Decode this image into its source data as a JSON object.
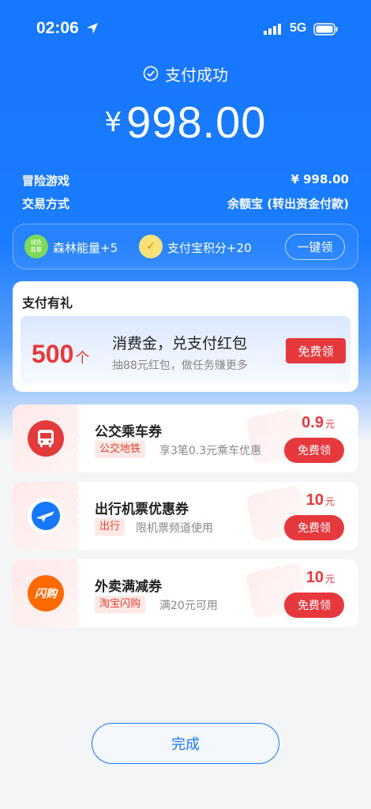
{
  "status_bar": {
    "time": "02:06",
    "network": "5G",
    "icons": [
      "location-arrow-icon",
      "signal-icon",
      "battery-icon"
    ]
  },
  "header": {
    "status_text": "支付成功",
    "currency": "¥",
    "amount": "998.00"
  },
  "details": {
    "item_label": "冒险游戏",
    "item_value": "¥ 998.00",
    "method_label": "交易方式",
    "method_value": "余额宝 (转出资金付款)"
  },
  "bonus_bar": {
    "forest_icon_text": "绿色能量",
    "forest_label": "森林能量+5",
    "points_label": "支付宝积分+20",
    "collect_all_button": "一键领"
  },
  "gift": {
    "title": "支付有礼",
    "count": "500",
    "count_unit": "个",
    "headline": "消费金，兑支付红包",
    "subline": "抽88元红包，做任务赚更多",
    "button": "免费领"
  },
  "coupons": [
    {
      "name": "公交乘车券",
      "tag": "公交地铁",
      "desc": "享3笔0.3元乘车优惠",
      "value": "0.9",
      "unit": "元",
      "button": "免费领",
      "icon": "bus-icon"
    },
    {
      "name": "出行机票优惠券",
      "tag": "出行",
      "desc": "限机票频道使用",
      "value": "10",
      "unit": "元",
      "button": "免费领",
      "icon": "airplane-icon"
    },
    {
      "name": "外卖满减券",
      "tag": "淘宝闪购",
      "desc": "满20元可用",
      "value": "10",
      "unit": "元",
      "button": "免费领",
      "icon": "flash-buy-icon",
      "icon_text": "闪购"
    }
  ],
  "footer": {
    "done_button": "完成"
  },
  "colors": {
    "brand_blue": "#1677ff",
    "accent_red": "#e6393d"
  }
}
